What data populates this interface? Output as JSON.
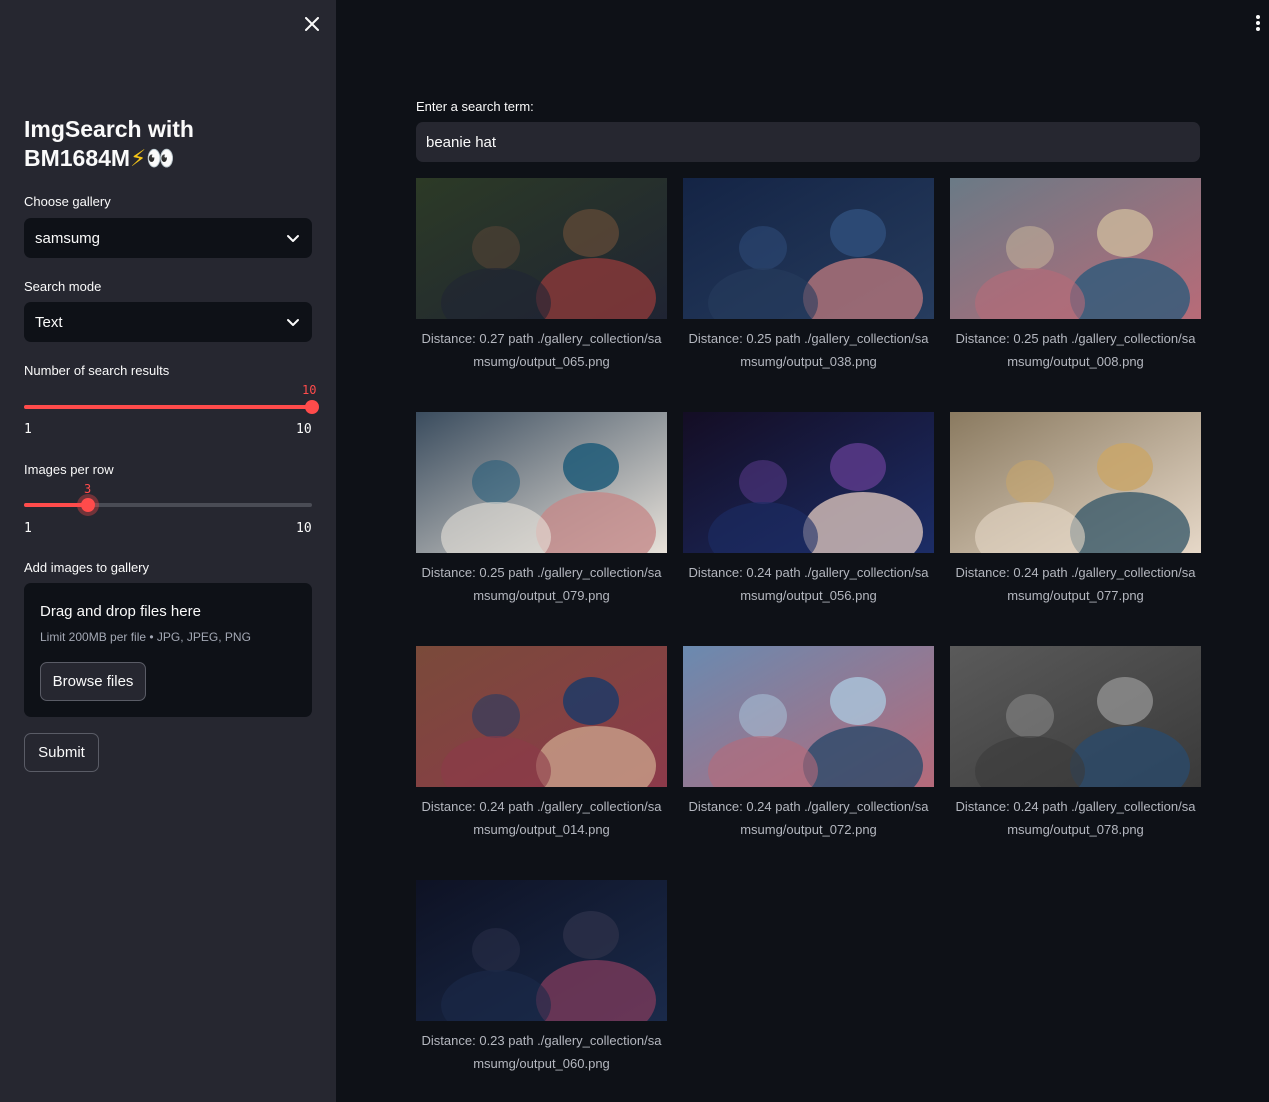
{
  "sidebar": {
    "title_line1": "ImgSearch with",
    "title_line2": "BM1684M",
    "title_emoji_bolt": "⚡",
    "title_emoji_eyes": "👀",
    "gallery_label": "Choose gallery",
    "gallery_value": "samsumg",
    "mode_label": "Search mode",
    "mode_value": "Text",
    "num_results_label": "Number of search results",
    "num_results": {
      "value": "10",
      "min": "1",
      "max": "10",
      "fraction": 1.0
    },
    "per_row_label": "Images per row",
    "per_row": {
      "value": "3",
      "min": "1",
      "max": "10",
      "fraction": 0.222
    },
    "add_label": "Add images to gallery",
    "uploader_title": "Drag and drop files here",
    "uploader_limit": "Limit 200MB per file • JPG, JPEG, PNG",
    "browse_label": "Browse files",
    "submit_label": "Submit"
  },
  "main": {
    "search_label": "Enter a search term:",
    "search_value": "beanie hat",
    "results": [
      {
        "caption": "Distance: 0.27 path ./gallery_collection/samsumg/output_065.png"
      },
      {
        "caption": "Distance: 0.25 path ./gallery_collection/samsumg/output_038.png"
      },
      {
        "caption": "Distance: 0.25 path ./gallery_collection/samsumg/output_008.png"
      },
      {
        "caption": "Distance: 0.25 path ./gallery_collection/samsumg/output_079.png"
      },
      {
        "caption": "Distance: 0.24 path ./gallery_collection/samsumg/output_056.png"
      },
      {
        "caption": "Distance: 0.24 path ./gallery_collection/samsumg/output_077.png"
      },
      {
        "caption": "Distance: 0.24 path ./gallery_collection/samsumg/output_014.png"
      },
      {
        "caption": "Distance: 0.24 path ./gallery_collection/samsumg/output_072.png"
      },
      {
        "caption": "Distance: 0.24 path ./gallery_collection/samsumg/output_078.png"
      },
      {
        "caption": "Distance: 0.23 path ./gallery_collection/samsumg/output_060.png"
      }
    ]
  },
  "colors": {
    "accent": "#ff4b4b",
    "sidebar_bg": "#262730",
    "main_bg": "#0e1117"
  }
}
